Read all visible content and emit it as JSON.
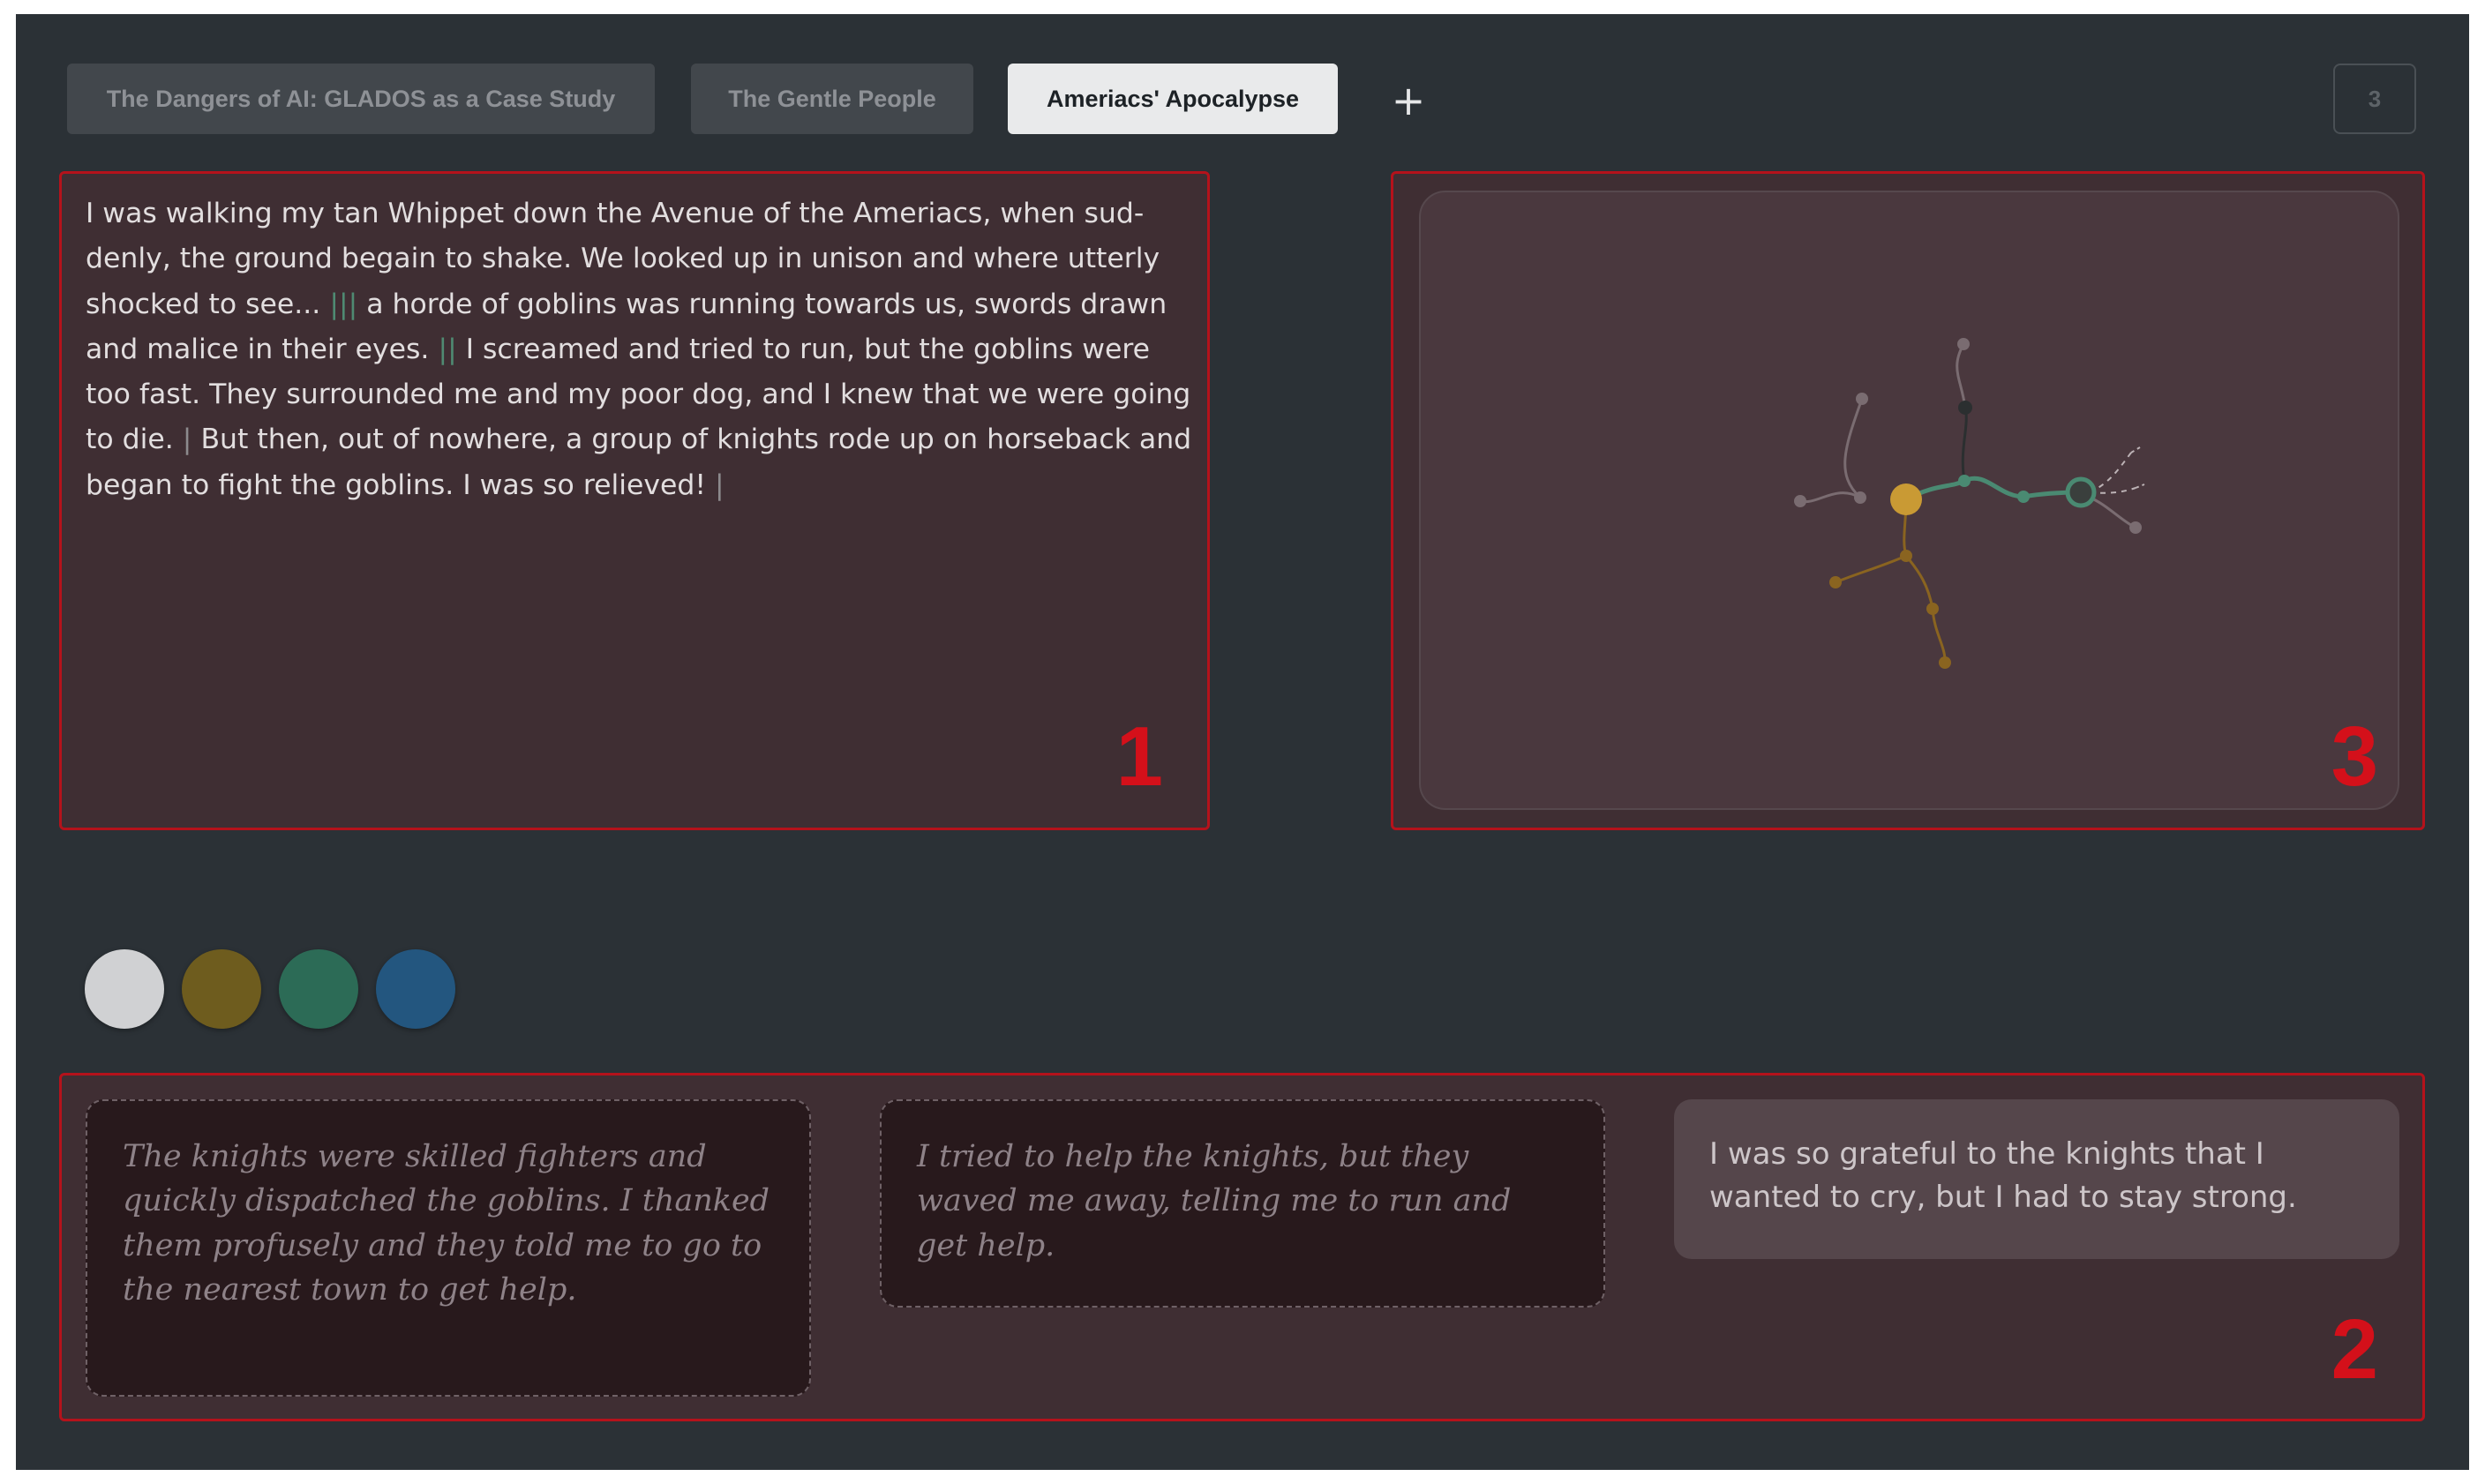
{
  "tabs": [
    {
      "label": "The Dangers of AI: GLADOS as a Case Study",
      "active": false
    },
    {
      "label": "The Gentle People",
      "active": false
    },
    {
      "label": "Ameriacs' Apocalypse",
      "active": true
    }
  ],
  "add_tab_label": "+",
  "page_counter": "3",
  "story": {
    "segments": [
      {
        "text": "I was walking my tan Whippet down the Avenue of the Ameriacs, when sud­denly, the ground begain to shake. We looked up in unison and where utterly shocked to see...",
        "sep": "|||"
      },
      {
        "text": "a horde of goblins was running towards us, swords drawn and malice in their eyes.",
        "sep": "||"
      },
      {
        "text": "I screamed and tried to run, but the gob­lins were too fast. They surrounded me and my poor dog, and I knew that we were going to die.",
        "sep": "|"
      },
      {
        "text": "But then, out of nowhere, a group of knights rode up on horseback and began to fight the goblins. I was so relieved!",
        "sep": "|"
      }
    ]
  },
  "panel_numbers": {
    "story": "1",
    "choices": "2",
    "tree": "3"
  },
  "color_dots": [
    {
      "name": "white-dot",
      "color": "#d0d1d3"
    },
    {
      "name": "gold-dot",
      "color": "#6e5c1e"
    },
    {
      "name": "green-dot",
      "color": "#2c6b56"
    },
    {
      "name": "blue-dot",
      "color": "#23567f"
    }
  ],
  "choices": [
    {
      "text": "The knights were skilled fighters and quickly dispatched the goblins. I thanked them profusely and they told me to go to the nearest town to get help.",
      "style": "dashed"
    },
    {
      "text": "I tried to help the knights, but they waved me away, telling me to run and get help.",
      "style": "dashed"
    },
    {
      "text": "I was so grateful to the knights that I wanted to cry, but I had to stay strong.",
      "style": "solid"
    }
  ],
  "tree_colors": {
    "gold": "#c99a34",
    "gold_dark": "#8a6420",
    "green": "#4a8a72",
    "gray": "#7a6c71",
    "dark": "#2b2f30"
  }
}
